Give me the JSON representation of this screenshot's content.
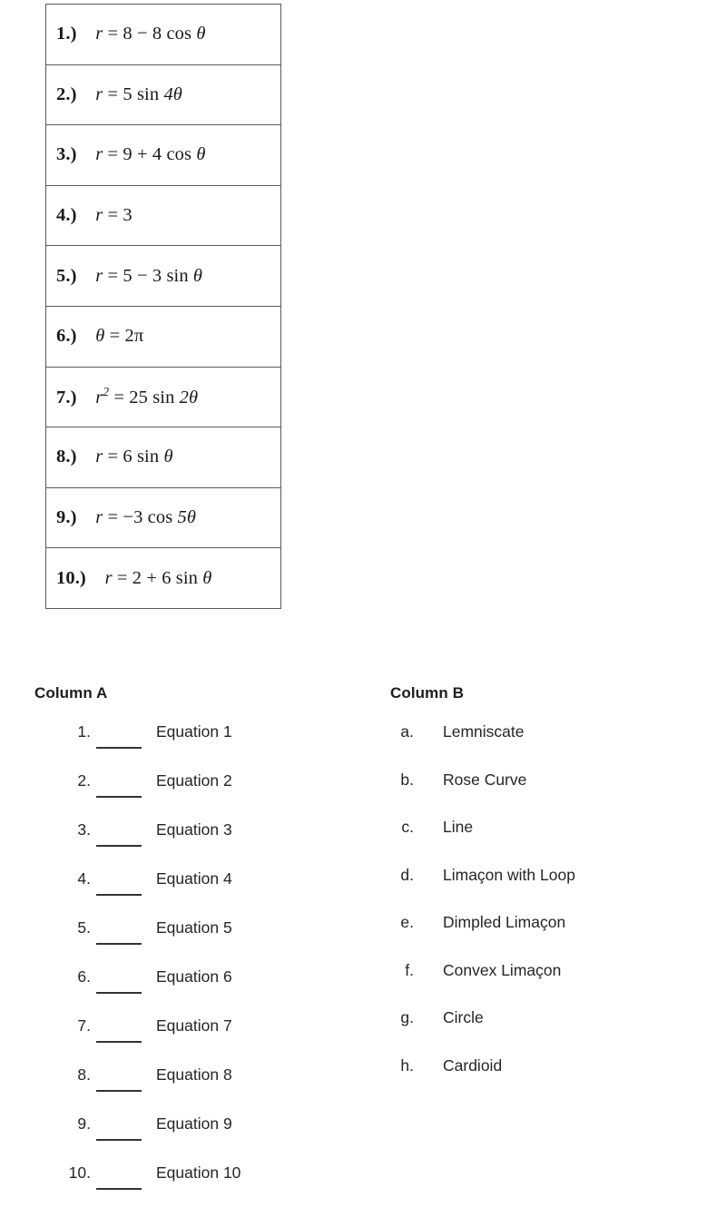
{
  "equation_table": {
    "rows": [
      {
        "number": "1.)",
        "equation_plain": "r = 8 - 8 cos θ",
        "parts": [
          "r",
          " = 8 − 8 ",
          "cos",
          " θ"
        ]
      },
      {
        "number": "2.)",
        "equation_plain": "r = 5 sin 4θ",
        "parts": [
          "r",
          " = 5 ",
          "sin",
          " 4θ"
        ]
      },
      {
        "number": "3.)",
        "equation_plain": "r = 9 + 4 cos θ",
        "parts": [
          "r",
          " = 9 + 4 ",
          "cos",
          " θ"
        ]
      },
      {
        "number": "4.)",
        "equation_plain": "r = 3",
        "parts": [
          "r",
          " = 3",
          "",
          ""
        ]
      },
      {
        "number": "5.)",
        "equation_plain": "r = 5 - 3 sin θ",
        "parts": [
          "r",
          " = 5 − 3 ",
          "sin",
          " θ"
        ]
      },
      {
        "number": "6.)",
        "equation_plain": "θ = 2π",
        "parts": [
          "θ",
          " = 2π",
          "",
          ""
        ]
      },
      {
        "number": "7.)",
        "equation_plain": "r² = 25 sin 2θ",
        "parts": [
          "r",
          " = 25 ",
          "sin",
          " 2θ"
        ],
        "superscript": "2"
      },
      {
        "number": "8.)",
        "equation_plain": "r = 6 sin θ",
        "parts": [
          "r",
          " = 6 ",
          "sin",
          " θ"
        ]
      },
      {
        "number": "9.)",
        "equation_plain": "r = -3 cos 5θ",
        "parts": [
          "r",
          " = −3 ",
          "cos",
          " 5θ"
        ]
      },
      {
        "number": "10.)",
        "equation_plain": "r = 2 + 6 sin θ",
        "parts": [
          "r",
          " = 2 + 6 ",
          "sin",
          " θ"
        ]
      }
    ]
  },
  "matching": {
    "column_a": {
      "header": "Column A",
      "items": [
        {
          "number": "1.",
          "label": "Equation 1",
          "answer": ""
        },
        {
          "number": "2.",
          "label": "Equation 2",
          "answer": ""
        },
        {
          "number": "3.",
          "label": "Equation 3",
          "answer": ""
        },
        {
          "number": "4.",
          "label": "Equation 4",
          "answer": ""
        },
        {
          "number": "5.",
          "label": "Equation 5",
          "answer": ""
        },
        {
          "number": "6.",
          "label": "Equation 6",
          "answer": ""
        },
        {
          "number": "7.",
          "label": "Equation 7",
          "answer": ""
        },
        {
          "number": "8.",
          "label": "Equation 8",
          "answer": ""
        },
        {
          "number": "9.",
          "label": "Equation 9",
          "answer": ""
        },
        {
          "number": "10.",
          "label": "Equation 10",
          "answer": ""
        }
      ]
    },
    "column_b": {
      "header": "Column B",
      "items": [
        {
          "marker": "a.",
          "label": "Lemniscate"
        },
        {
          "marker": "b.",
          "label": "Rose Curve"
        },
        {
          "marker": "c.",
          "label": "Line"
        },
        {
          "marker": "d.",
          "label": "Limaçon with Loop"
        },
        {
          "marker": "e.",
          "label": "Dimpled Limaçon"
        },
        {
          "marker": "f.",
          "label": "Convex Limaçon"
        },
        {
          "marker": "g.",
          "label": "Circle"
        },
        {
          "marker": "h.",
          "label": "Cardioid"
        }
      ]
    }
  },
  "colors": {
    "page_background": "#ffffff",
    "table_border": "#5a5a5a",
    "text": "#262626",
    "blank_line": "#333333"
  }
}
